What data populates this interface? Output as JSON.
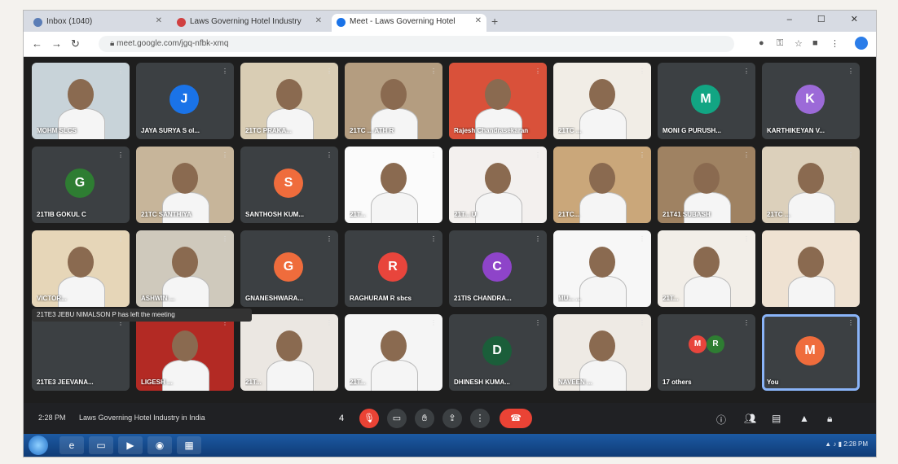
{
  "browser": {
    "tabs": [
      {
        "label": "Inbox (1040)",
        "color": "#5b7db6"
      },
      {
        "label": "Laws Governing Hotel Industry",
        "color": "#d04040"
      },
      {
        "label": "Meet - Laws Governing Hotel",
        "color": "#1a73e8"
      }
    ],
    "new_tab": "+",
    "url": "meet.google.com/jgq-nfbk-xmq",
    "window_controls": "– ☐ ✕"
  },
  "participants": [
    {
      "name": "MOHM SLCS",
      "type": "camera",
      "bg": "#c8d3d9"
    },
    {
      "name": "JAYA SURYA S ol...",
      "type": "avatar",
      "initial": "J",
      "color": "#1a73e8"
    },
    {
      "name": "21TC PRAKA...",
      "type": "camera",
      "bg": "#d9cdb4"
    },
    {
      "name": "21TC ... ATH R",
      "type": "camera",
      "bg": "#b49d80"
    },
    {
      "name": "Rajesh Chandrasekaran",
      "type": "camera",
      "bg": "#d9513a"
    },
    {
      "name": "21TC ...",
      "type": "camera",
      "bg": "#f1ede6"
    },
    {
      "name": "MONI G PURUSH...",
      "type": "avatar",
      "initial": "M",
      "color": "#12a583"
    },
    {
      "name": "KARTHIKEYAN V...",
      "type": "avatar",
      "initial": "K",
      "color": "#9c6ad8"
    },
    {
      "name": "21TIB GOKUL C",
      "type": "avatar",
      "initial": "G",
      "color": "#2e7d32"
    },
    {
      "name": "21TC SANTHIYA",
      "type": "camera",
      "bg": "#c7b59a"
    },
    {
      "name": "SANTHOSH KUM...",
      "type": "avatar",
      "initial": "S",
      "color": "#ef6c3c"
    },
    {
      "name": "21T...",
      "type": "camera",
      "bg": "#fbfbfb"
    },
    {
      "name": "21T... U",
      "type": "camera",
      "bg": "#f3f0ee"
    },
    {
      "name": "21TC...",
      "type": "camera",
      "bg": "#caa77a"
    },
    {
      "name": "21T41 SUBASH",
      "type": "camera",
      "bg": "#9f8262"
    },
    {
      "name": "21TC ...",
      "type": "camera",
      "bg": "#dcd0bb"
    },
    {
      "name": "VICTOR...",
      "type": "camera",
      "bg": "#e6d6b8"
    },
    {
      "name": "ASHWIN ...",
      "type": "camera",
      "bg": "#cfc9bc"
    },
    {
      "name": "GNANESHWARA...",
      "type": "avatar",
      "initial": "G",
      "color": "#ef6c3c"
    },
    {
      "name": "RAGHURAM R sbcs",
      "type": "avatar",
      "initial": "R",
      "color": "#e8453c"
    },
    {
      "name": "21TIS CHANDRA...",
      "type": "avatar",
      "initial": "C",
      "color": "#8e44c9"
    },
    {
      "name": "MU... ...",
      "type": "camera",
      "bg": "#f7f7f7"
    },
    {
      "name": "21T...",
      "type": "camera",
      "bg": "#f2eee8"
    },
    {
      "name": "",
      "type": "camera",
      "bg": "#efe2d2"
    },
    {
      "name": "21TE3 JEEVANA...",
      "type": "camera",
      "bg": "#3c4043"
    },
    {
      "name": "LIGESH ...",
      "type": "camera",
      "bg": "#b32a24"
    },
    {
      "name": "21T...",
      "type": "camera",
      "bg": "#ebe7e2"
    },
    {
      "name": "21T...",
      "type": "camera",
      "bg": "#f5f5f5"
    },
    {
      "name": "DHINESH KUMA...",
      "type": "avatar",
      "initial": "D",
      "color": "#1b5e3a"
    },
    {
      "name": "NAVEEN ...",
      "type": "camera",
      "bg": "#eeeae4"
    },
    {
      "name": "17 others",
      "type": "others",
      "initials": [
        "M",
        "R"
      ],
      "colors": [
        "#e8453c",
        "#2e7d32"
      ]
    },
    {
      "name": "You",
      "type": "avatar",
      "initial": "M",
      "color": "#ef6c3c",
      "active": true
    }
  ],
  "notice": "21TE3 JEBU NIMALSON P has left the meeting",
  "controls": {
    "time": "2:28 PM",
    "meeting_title": "Laws Governing Hotel Industry in India",
    "participant_count": "4",
    "buttons": [
      "mic-button",
      "camera-button",
      "captions-button",
      "hand-button",
      "present-button",
      "more-button",
      "leave-button"
    ],
    "right_icons": [
      "info-icon",
      "people-icon",
      "chat-icon",
      "activities-icon",
      "host-controls-icon"
    ]
  },
  "taskbar": {
    "apps": [
      "ie",
      "folder",
      "media",
      "chrome",
      "explorer"
    ],
    "clock": "2:28 PM"
  }
}
